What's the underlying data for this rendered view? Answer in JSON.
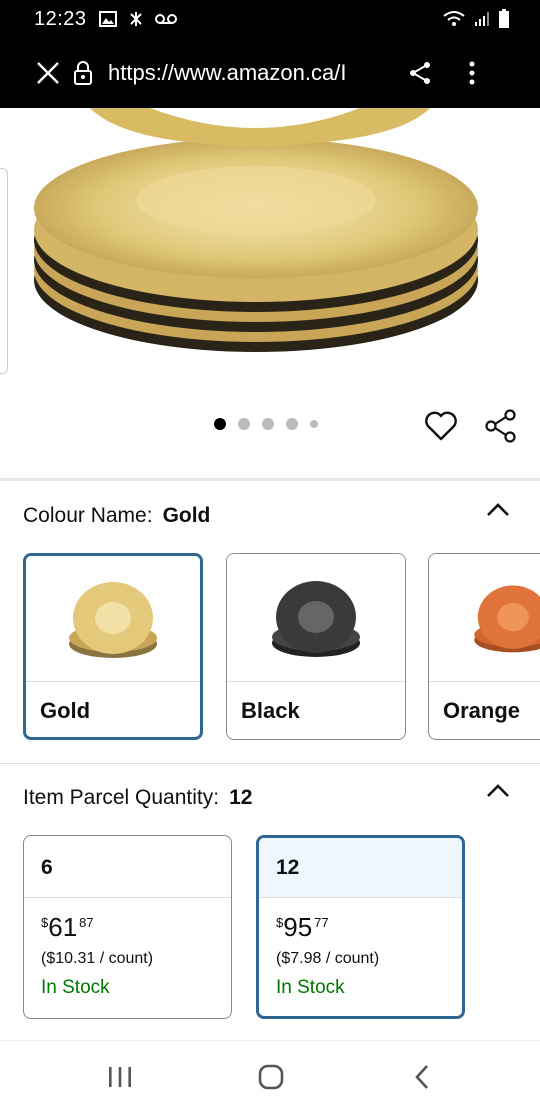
{
  "status_bar": {
    "time": "12:23"
  },
  "browser": {
    "url": "https://www.amazon.ca/I"
  },
  "colour": {
    "label": "Colour Name:",
    "selected": "Gold",
    "options": [
      {
        "label": "Gold",
        "color": "#d8b64e"
      },
      {
        "label": "Black",
        "color": "#3a3a3a"
      },
      {
        "label": "Orange",
        "color": "#e0733a"
      }
    ]
  },
  "quantity": {
    "label": "Item Parcel Quantity:",
    "selected": "12",
    "options": [
      {
        "qty": "6",
        "currency": "$",
        "whole": "61",
        "fraction": "87",
        "per_count": "($10.31 / count)",
        "stock": "In Stock"
      },
      {
        "qty": "12",
        "currency": "$",
        "whole": "95",
        "fraction": "77",
        "per_count": "($7.98 / count)",
        "stock": "In Stock"
      }
    ]
  },
  "icons": {
    "status_left": [
      "gallery-icon",
      "bluetooth-muted-icon",
      "voicemail-icon"
    ],
    "status_right": [
      "wifi-icon",
      "signal-icon",
      "battery-icon"
    ],
    "browser": [
      "close-icon",
      "lock-icon",
      "share-icon",
      "more-vert-icon"
    ],
    "product": [
      "heart-icon",
      "share-icon"
    ],
    "nav": [
      "recents-icon",
      "home-icon",
      "back-icon"
    ]
  },
  "colors": {
    "accent": "#2f6694",
    "in_stock": "#007600",
    "selected_bg": "#eef7fd"
  }
}
